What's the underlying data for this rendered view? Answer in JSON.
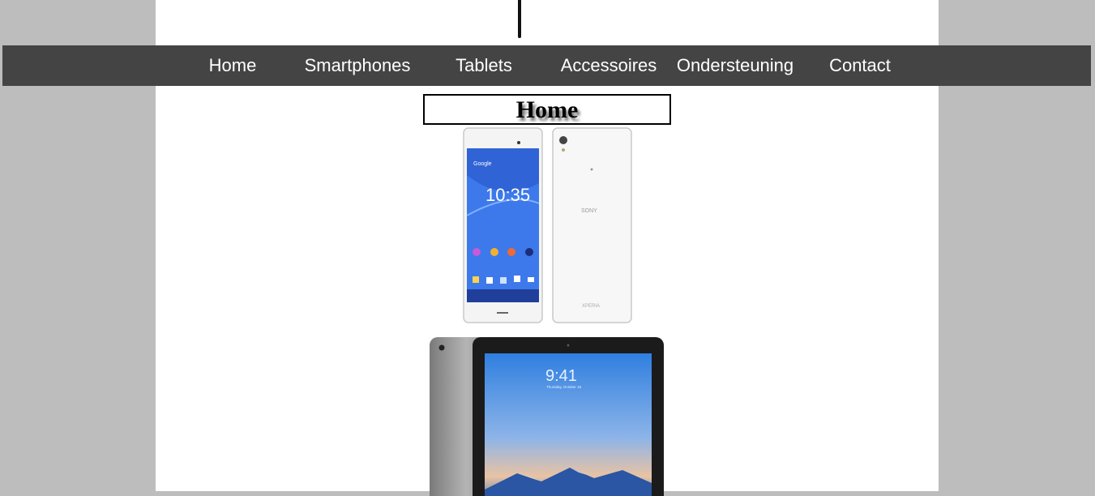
{
  "nav": {
    "items": [
      {
        "label": "Home"
      },
      {
        "label": "Smartphones"
      },
      {
        "label": "Tablets"
      },
      {
        "label": "Accessoires"
      },
      {
        "label": "Ondersteuning"
      },
      {
        "label": "Contact"
      }
    ]
  },
  "main": {
    "title": "Home"
  },
  "images": {
    "phones": {
      "icon": "smartphone-product-image",
      "screen_time": "10:35",
      "brand_back": "SONY",
      "model_back": "XPERIA",
      "app_label": "Google"
    },
    "tablet": {
      "icon": "tablet-product-image",
      "screen_time": "9:41",
      "screen_date": "Thursday, October 16"
    }
  },
  "colors": {
    "background": "#bdbdbd",
    "page": "#ffffff",
    "navbar": "#444444",
    "nav_text": "#ffffff"
  }
}
